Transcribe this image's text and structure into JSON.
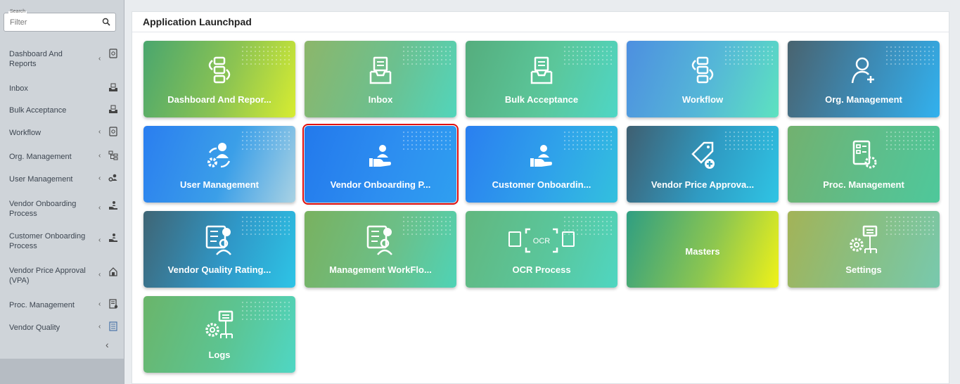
{
  "sidebar": {
    "search": {
      "label": "Search",
      "placeholder": "Filter"
    },
    "items": [
      {
        "label": "Dashboard And Reports",
        "chevron": "‹",
        "icon": "dashboard-report-icon"
      },
      {
        "label": "Inbox",
        "chevron": "",
        "icon": "inbox-tray-icon"
      },
      {
        "label": "Bulk Acceptance",
        "chevron": "",
        "icon": "inbox-tray-icon"
      },
      {
        "label": "Workflow",
        "chevron": "‹",
        "icon": "dashboard-report-icon"
      },
      {
        "label": "Org. Management",
        "chevron": "‹",
        "icon": "org-chart-icon"
      },
      {
        "label": "User Management",
        "chevron": "‹",
        "icon": "users-gear-icon"
      },
      {
        "label": "Vendor Onboarding Process",
        "chevron": "‹",
        "icon": "hand-user-icon"
      },
      {
        "label": "Customer Onboarding Process",
        "chevron": "‹",
        "icon": "hand-user-icon"
      },
      {
        "label": "Vendor Price Approval (VPA)",
        "chevron": "‹",
        "icon": "price-house-icon"
      },
      {
        "label": "Proc. Management",
        "chevron": "‹",
        "icon": "document-gear-icon"
      },
      {
        "label": "Vendor Quality",
        "chevron": "‹",
        "icon": "checklist-icon"
      }
    ],
    "collapse_chevron": "‹"
  },
  "main": {
    "title": "Application Launchpad",
    "tiles": [
      {
        "label": "Dashboard And Repor...",
        "icon": "workflow-list-icon"
      },
      {
        "label": "Inbox",
        "icon": "inbox-tray-icon"
      },
      {
        "label": "Bulk Acceptance",
        "icon": "inbox-tray-icon"
      },
      {
        "label": "Workflow",
        "icon": "workflow-list-icon"
      },
      {
        "label": "Org. Management",
        "icon": "user-add-icon"
      },
      {
        "label": "User Management",
        "icon": "user-gear-icon"
      },
      {
        "label": "Vendor Onboarding P...",
        "icon": "hand-user-icon",
        "selected": true
      },
      {
        "label": "Customer Onboardin...",
        "icon": "hand-user-icon"
      },
      {
        "label": "Vendor Price Approva...",
        "icon": "price-tag-icon"
      },
      {
        "label": "Proc. Management",
        "icon": "document-gear-icon"
      },
      {
        "label": "Vendor Quality Rating...",
        "icon": "checklist-person-icon"
      },
      {
        "label": "Management WorkFlo...",
        "icon": "checklist-person-icon"
      },
      {
        "label": "OCR Process",
        "icon": "ocr-scan-icon",
        "icon_text": "OCR"
      },
      {
        "label": "Masters",
        "icon": ""
      },
      {
        "label": "Settings",
        "icon": "gear-flow-icon"
      },
      {
        "label": "Logs",
        "icon": "gear-flow-icon"
      }
    ]
  },
  "colors": {
    "selection_outline": "#e01010",
    "sidebar_bg": "#cfd4d9",
    "tile_text": "#ffffff"
  }
}
